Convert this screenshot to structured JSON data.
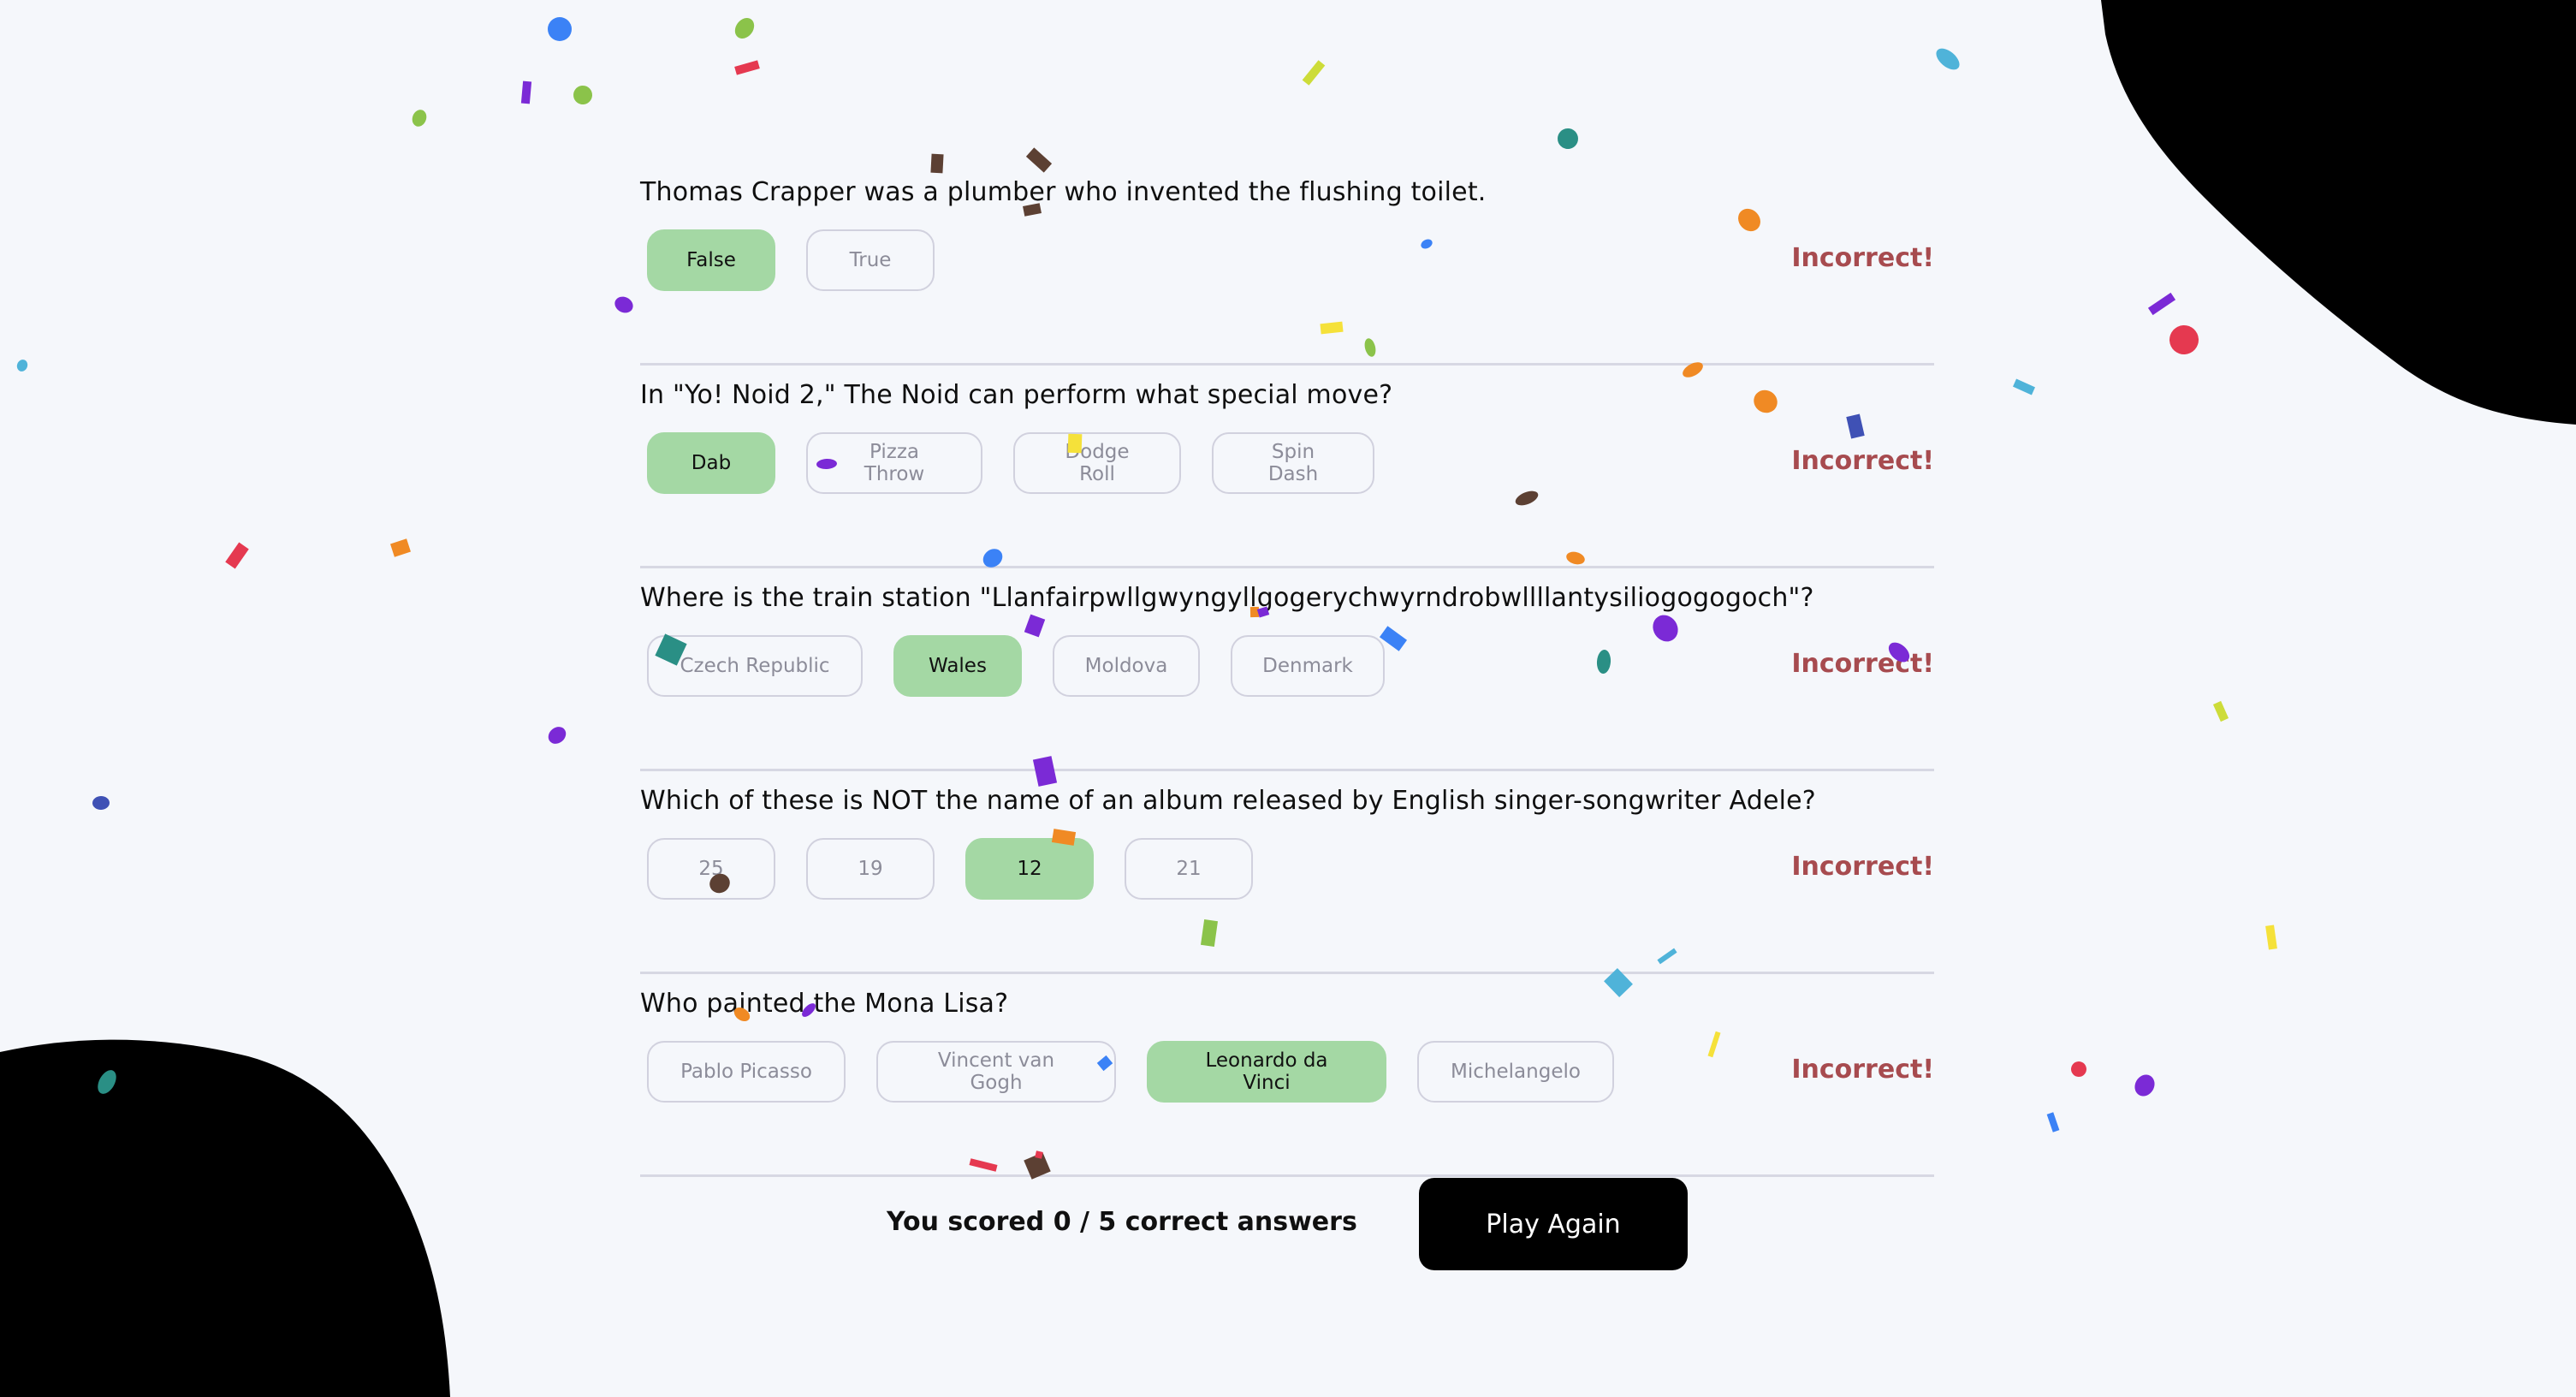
{
  "quiz": {
    "questions": [
      {
        "text": "Thomas Crapper was a plumber who invented the flushing toilet.",
        "answers": [
          "False",
          "True"
        ],
        "selected": 0,
        "result": "Incorrect!"
      },
      {
        "text": "In \"Yo! Noid 2,\" The Noid can perform what special move?",
        "answers": [
          "Dab",
          "Pizza Throw",
          "Dodge Roll",
          "Spin Dash"
        ],
        "selected": 0,
        "result": "Incorrect!"
      },
      {
        "text": "Where is the train station \"Llanfairpwllgwyngyllgogerychwyrndrobwllllantysiliogogogoch\"?",
        "answers": [
          "Czech Republic",
          "Wales",
          "Moldova",
          "Denmark"
        ],
        "selected": 1,
        "result": "Incorrect!"
      },
      {
        "text": "Which of these is NOT the name of an album released by English singer-songwriter Adele?",
        "answers": [
          "25",
          "19",
          "12",
          "21"
        ],
        "selected": 2,
        "result": "Incorrect!"
      },
      {
        "text": "Who painted the Mona Lisa?",
        "answers": [
          "Pablo Picasso",
          "Vincent van Gogh",
          "Leonardo da Vinci",
          "Michelangelo"
        ],
        "selected": 2,
        "result": "Incorrect!"
      }
    ]
  },
  "footer": {
    "score_text": "You scored 0 / 5 correct answers",
    "play_again_label": "Play Again"
  },
  "colors": {
    "background": "#f5f7fb",
    "selected_answer": "#a4d8a4",
    "incorrect_text": "#a74b4f",
    "blob": "#000000",
    "button": "#000000"
  },
  "confetti_colors": [
    "#3b82f6",
    "#8bc34a",
    "#e53950",
    "#7b2ad6",
    "#5c4033",
    "#2a8f85",
    "#f08a24",
    "#f5e13a",
    "#4fb3d9",
    "#3f51b5",
    "#cddc39"
  ]
}
